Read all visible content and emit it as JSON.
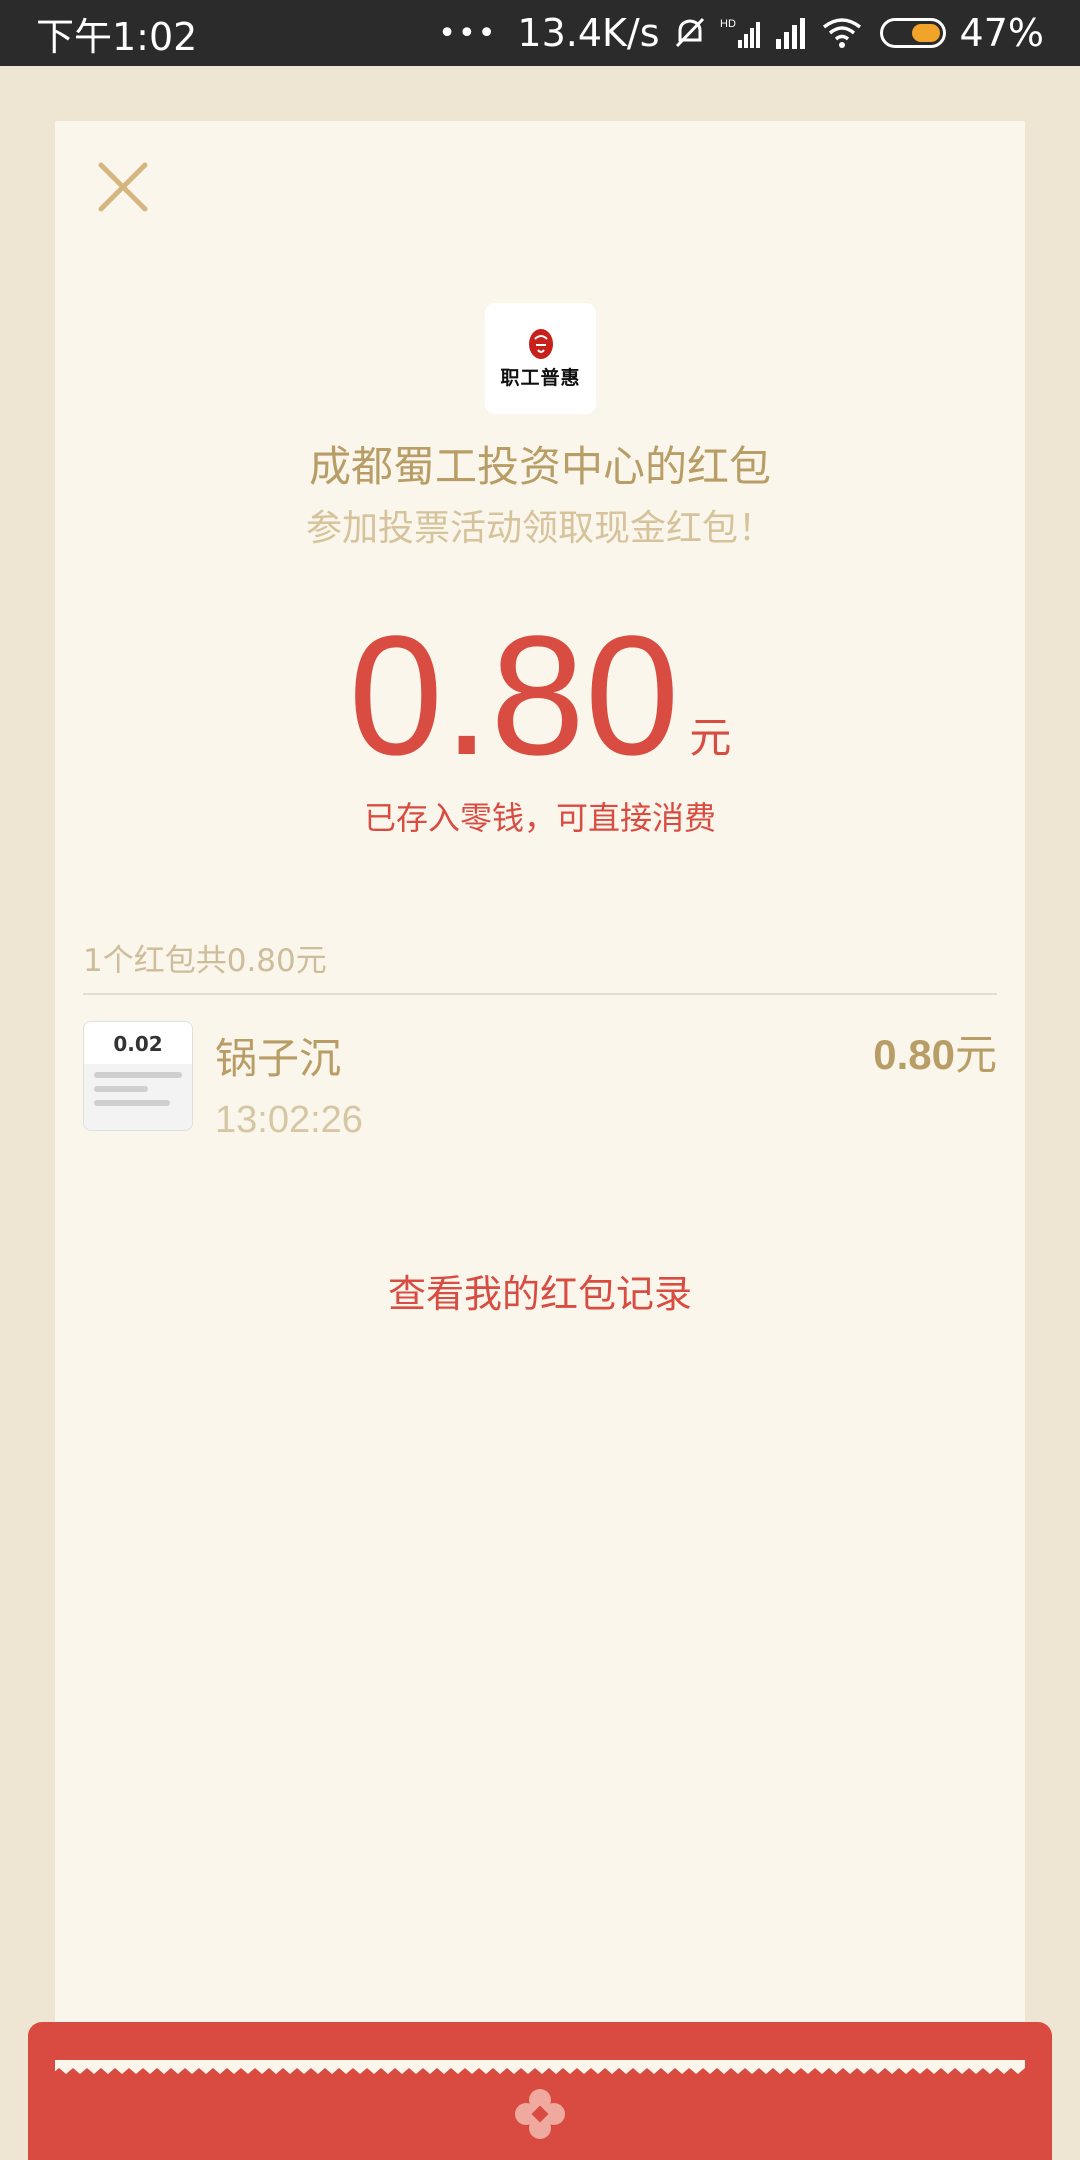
{
  "status_bar": {
    "time": "下午1:02",
    "dots": "•••",
    "net_speed": "13.4K/s",
    "battery": "47%",
    "battery_level": 0.47,
    "icons": [
      "mute-bell-icon",
      "hd-signal-icon",
      "signal-icon",
      "wifi-icon",
      "battery-icon"
    ]
  },
  "envelope": {
    "logo_text": "职工普惠",
    "sender_name": "成都蜀工投资中心的红包",
    "wish": "参加投票活动领取现金红包！",
    "amount": "0.80",
    "amount_unit": "元",
    "deposit_note": "已存入零钱，可直接消费",
    "close_icon": "close-icon"
  },
  "records": {
    "summary": "1个红包共0.80元",
    "items": [
      {
        "name": "锅子沉",
        "time": "13:02:26",
        "amount": "0.80",
        "unit": "元",
        "avatar_text": "0.02"
      }
    ]
  },
  "view_records_label": "查看我的红包记录",
  "colors": {
    "accent_red": "#d94c41",
    "gold": "#b89e66",
    "background": "#eee5d3",
    "card": "#faf6ec"
  }
}
